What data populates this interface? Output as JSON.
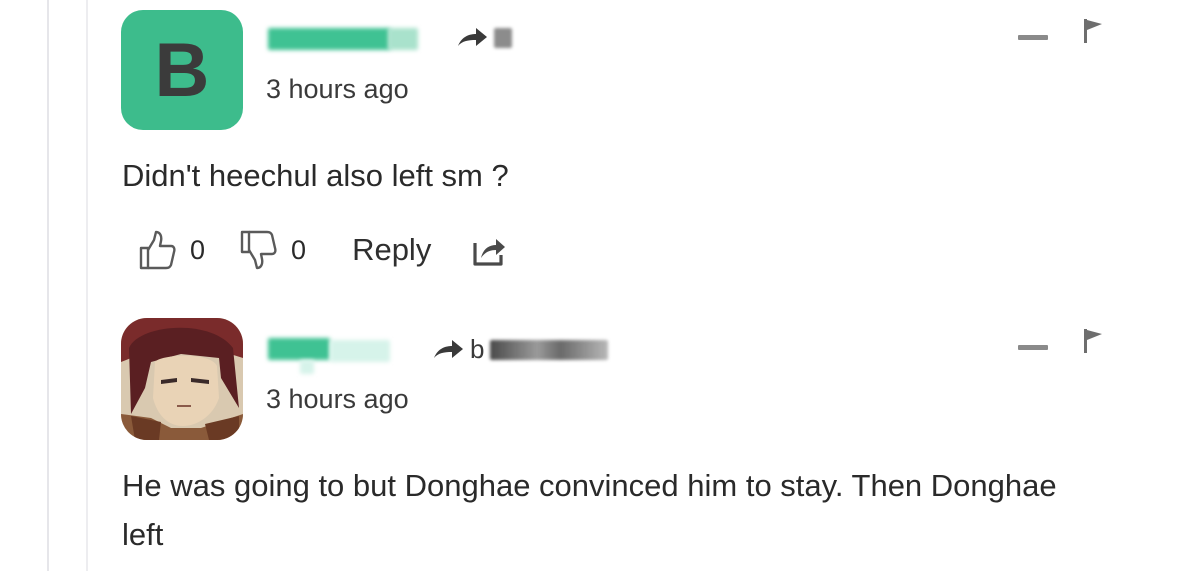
{
  "comments": [
    {
      "avatar_letter": "B",
      "avatar_color": "#3dbc8c",
      "timestamp": "3 hours ago",
      "text": "Didn't heechul also left sm ?",
      "likes": "0",
      "dislikes": "0",
      "reply_label": "Reply",
      "icons": {
        "reply_to": "share-arrow-icon",
        "collapse": "minus-icon",
        "flag": "flag-icon",
        "like": "thumbs-up-icon",
        "dislike": "thumbs-down-icon",
        "share": "share-icon"
      }
    },
    {
      "reply_to_visible": "b",
      "timestamp": "3 hours ago",
      "text": "He was going to but Donghae convinced him to stay. Then Donghae left",
      "icons": {
        "avatar": "anime-character-avatar",
        "reply_to": "share-arrow-icon",
        "collapse": "minus-icon",
        "flag": "flag-icon"
      }
    }
  ],
  "colors": {
    "username_redacted": "#3fc293",
    "icon_gray": "#8a8a8a",
    "text": "#2a2a2a"
  }
}
